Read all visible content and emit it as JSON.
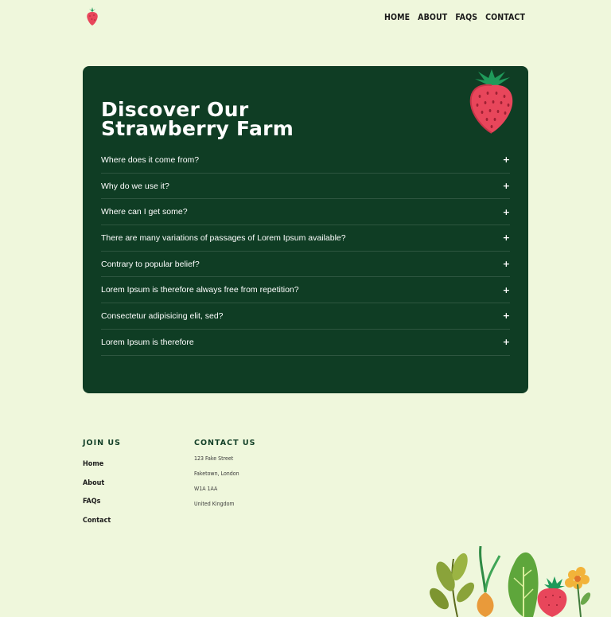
{
  "header": {
    "logo_icon": "strawberry-icon",
    "nav": [
      "HOME",
      "ABOUT",
      "FAQS",
      "CONTACT"
    ]
  },
  "faq": {
    "title_line1": "Discover Our",
    "title_line2": "Strawberry Farm",
    "illustration": "strawberry-illustration",
    "expand_icon": "plus-icon",
    "items": [
      "Where does it come from?",
      "Why do we use it?",
      "Where can I get some?",
      "There are many variations of passages of Lorem Ipsum available?",
      "Contrary to popular belief?",
      "Lorem Ipsum is therefore always free from repetition?",
      "Consectetur adipisicing elit, sed?",
      "Lorem Ipsum is therefore"
    ]
  },
  "footer": {
    "join_heading": "JOIN US",
    "join_links": [
      "Home",
      "About",
      "FAQs",
      "Contact"
    ],
    "contact_heading": "CONTACT US",
    "contact_lines": [
      "123 Fake Street",
      "Faketown, London",
      "W1A 1AA",
      "United Kingdom"
    ],
    "decoration": "vegetables-illustration"
  },
  "colors": {
    "background": "#eff7dc",
    "card": "#0f3d24",
    "strawberry": "#e8465b",
    "leaf": "#1f9a5a"
  }
}
